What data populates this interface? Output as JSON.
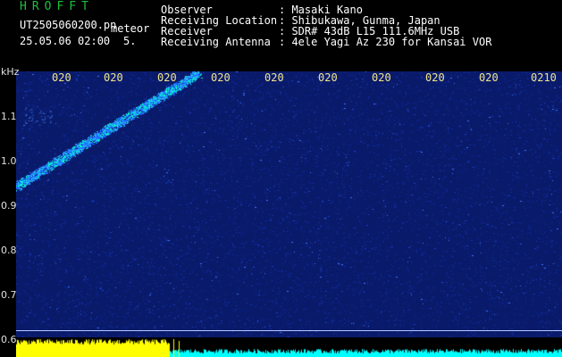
{
  "app": {
    "title": "HROFFT",
    "filename": "UT2505060200.pn",
    "meteor_label": "meteor",
    "datetime": "25.05.06 02:00",
    "count": "5."
  },
  "info": [
    {
      "label": "Observer",
      "value": ": Masaki Kano"
    },
    {
      "label": "Receiving Location",
      "value": ": Shibukawa, Gunma, Japan"
    },
    {
      "label": "Receiver",
      "value": ": SDR# 43dB L15 111.6MHz USB"
    },
    {
      "label": "Receiving Antenna",
      "value": ": 4ele Yagi Az 230 for Kansai VOR"
    }
  ],
  "axis": {
    "unit": "kHz",
    "y_ticks": [
      "1.1",
      "1.0",
      "0.9",
      "0.8",
      "0.7",
      "0.6"
    ],
    "time_ticks": [
      "020",
      "020",
      "020",
      "020",
      "020",
      "020",
      "020",
      "020",
      "020",
      "0210"
    ]
  },
  "colors": {
    "title_green": "#19c23a",
    "tick_yellow": "#f0e68c",
    "background_blue": "#0a1a6a",
    "meteor_trace": "#00ffc8",
    "power_yellow": "#ffff00",
    "power_cyan": "#00ffff"
  }
}
